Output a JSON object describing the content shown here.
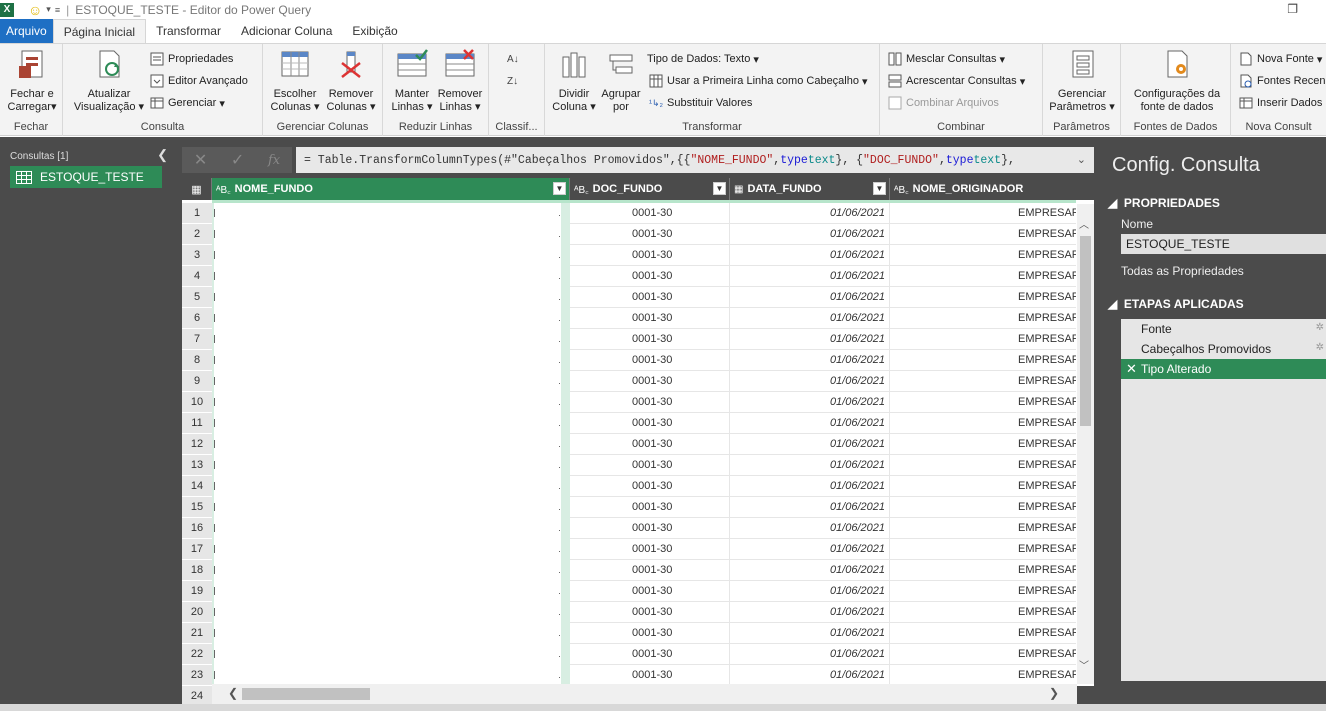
{
  "window": {
    "title": "ESTOQUE_TESTE - Editor do Power Query"
  },
  "tabs": [
    {
      "label": "Arquivo"
    },
    {
      "label": "Página Inicial"
    },
    {
      "label": "Transformar"
    },
    {
      "label": "Adicionar Coluna"
    },
    {
      "label": "Exibição"
    }
  ],
  "ribbon": {
    "groups": {
      "fechar": "Fechar",
      "consulta": "Consulta",
      "gerenciar_colunas": "Gerenciar Colunas",
      "reduzir_linhas": "Reduzir Linhas",
      "classificar": "Classif...",
      "transformar": "Transformar",
      "combinar": "Combinar",
      "parametros": "Parâmetros",
      "fontes_dados": "Fontes de Dados",
      "nova_consulta": "Nova Consult"
    },
    "fechar_carregar": [
      "Fechar e",
      "Carregar"
    ],
    "atualizar": [
      "Atualizar",
      "Visualização"
    ],
    "propriedades": "Propriedades",
    "editor_avancado": "Editor Avançado",
    "gerenciar": "Gerenciar",
    "escolher_colunas": [
      "Escolher",
      "Colunas"
    ],
    "remover_colunas": [
      "Remover",
      "Colunas"
    ],
    "manter_linhas": [
      "Manter",
      "Linhas"
    ],
    "remover_linhas": [
      "Remover",
      "Linhas"
    ],
    "dividir_coluna": [
      "Dividir",
      "Coluna"
    ],
    "agrupar_por": [
      "Agrupar",
      "por"
    ],
    "tipo_dados": "Tipo de Dados: Texto",
    "primeira_linha": "Usar a Primeira Linha como Cabeçalho",
    "substituir_valores": "Substituir Valores",
    "mesclar": "Mesclar Consultas",
    "acrescentar": "Acrescentar Consultas",
    "combinar_arquivos": "Combinar Arquivos",
    "gerenciar_parametros": [
      "Gerenciar",
      "Parâmetros"
    ],
    "config_fonte": [
      "Configurações da",
      "fonte de dados"
    ],
    "nova_fonte": "Nova Fonte",
    "fontes_recentes": "Fontes Recen",
    "inserir_dados": "Inserir Dados"
  },
  "queries_panel": {
    "header": "Consultas [1]",
    "items": [
      {
        "label": "ESTOQUE_TESTE"
      }
    ]
  },
  "formula": {
    "prefix": "= Table.TransformColumnTypes(#\"Cabeçalhos Promovidos\",{{",
    "s1": "\"NOME_FUNDO\"",
    "mid1": ", ",
    "kw1": "type",
    "t1": " text",
    "mid2": "}, {",
    "s2": "\"DOC_FUNDO\"",
    "mid3": ", ",
    "kw2": "type",
    "t2": " text",
    "end": "},"
  },
  "grid": {
    "columns": [
      {
        "type": "ABC",
        "name": "NOME_FUNDO"
      },
      {
        "type": "ABC",
        "name": "DOC_FUNDO"
      },
      {
        "type": "DATE",
        "name": "DATA_FUNDO"
      },
      {
        "type": "ABC",
        "name": "NOME_ORIGINADOR"
      }
    ],
    "doc_value": "0001-30",
    "date_value": "01/06/2021",
    "orig_value": "EMPRESARI.",
    "row_numbers": [
      1,
      2,
      3,
      4,
      5,
      6,
      7,
      8,
      9,
      10,
      11,
      12,
      13,
      14,
      15,
      16,
      17,
      18,
      19,
      20,
      21,
      22,
      23,
      24
    ]
  },
  "settings": {
    "title": "Config. Consulta",
    "propriedades": "PROPRIEDADES",
    "nome_label": "Nome",
    "nome_value": "ESTOQUE_TESTE",
    "todas_propriedades": "Todas as Propriedades",
    "etapas": "ETAPAS APLICADAS",
    "steps": [
      {
        "label": "Fonte"
      },
      {
        "label": "Cabeçalhos Promovidos"
      },
      {
        "label": "Tipo Alterado"
      }
    ]
  },
  "colors": {
    "accent_green": "#2e8b57",
    "file_tab_blue": "#1e6fc4",
    "panel_dark": "#4b4b4b"
  }
}
